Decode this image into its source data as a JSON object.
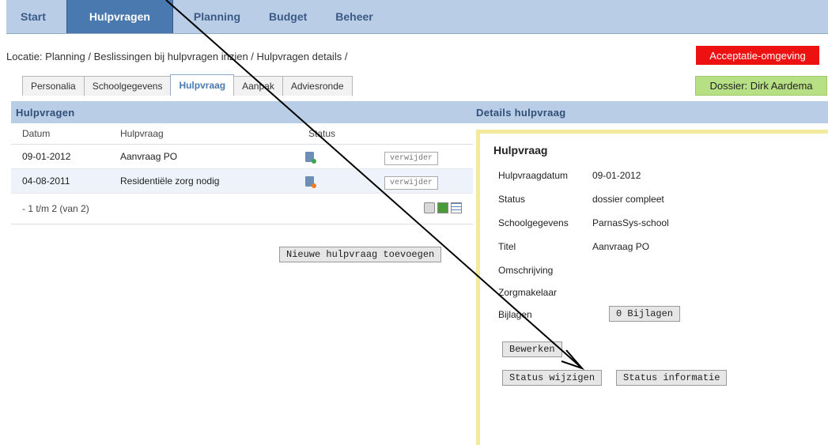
{
  "nav": {
    "items": [
      "Start",
      "Hulpvragen",
      "Planning",
      "Budget",
      "Beheer"
    ],
    "active": "Hulpvragen"
  },
  "breadcrumb": "Locatie: Planning / Beslissingen bij hulpvragen inzien / Hulpvragen details /",
  "environment_badge": "Acceptatie-omgeving",
  "tabs": [
    "Personalia",
    "Schoolgegevens",
    "Hulpvraag",
    "Aanpak",
    "Adviesronde"
  ],
  "dossier_badge": "Dossier: Dirk Aardema",
  "left_panel": {
    "title": "Hulpvragen",
    "columns": [
      "Datum",
      "Hulpvraag",
      "Status"
    ],
    "rows": [
      {
        "date": "09-01-2012",
        "question": "Aanvraag PO",
        "status_icon": "document-check-icon",
        "action": "verwijder"
      },
      {
        "date": "04-08-2011",
        "question": "Residentiële zorg nodig",
        "status_icon": "document-warning-icon",
        "action": "verwijder"
      }
    ],
    "pager": "- 1 t/m 2 (van 2)",
    "add_button": "Nieuwe hulpvraag toevoegen"
  },
  "right_panel": {
    "title": "Details hulpvraag",
    "section_title": "Hulpvraag",
    "fields": [
      {
        "label": "Hulpvraagdatum",
        "value": "09-01-2012"
      },
      {
        "label": "Status",
        "value": "dossier compleet"
      },
      {
        "label": "Schoolgegevens",
        "value": "ParnasSys-school"
      },
      {
        "label": "Titel",
        "value": "Aanvraag PO"
      },
      {
        "label": "Omschrijving",
        "value": ""
      },
      {
        "label": "Zorgmakelaar",
        "value": ""
      },
      {
        "label": "Bijlagen",
        "value": ""
      }
    ],
    "attachments_button": "0 Bijlagen",
    "edit_button": "Bewerken",
    "status_change_button": "Status wijzigen",
    "status_info_button": "Status informatie"
  },
  "colors": {
    "nav_bg": "#b9cde6",
    "nav_active": "#4a79b0",
    "env_badge": "#ee1111",
    "dossier_badge": "#b7df83",
    "details_border": "#f3ea9e"
  }
}
